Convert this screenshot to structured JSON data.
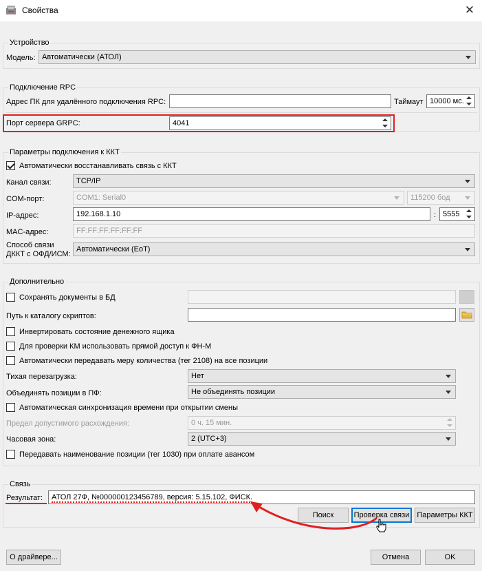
{
  "window": {
    "title": "Свойства",
    "close_glyph": "✕",
    "icon": "app-icon"
  },
  "device": {
    "legend": "Устройство",
    "model_label": "Модель:",
    "model_value": "Автоматически (АТОЛ)"
  },
  "rpc": {
    "legend": "Подключение RPC",
    "address_label": "Адрес ПК для удалённого подключения RPC:",
    "address_value": "",
    "timeout_label": "Таймаут",
    "timeout_value": "10000 мс.",
    "grpc_port_label": "Порт сервера GRPC:",
    "grpc_port_value": "4041"
  },
  "kkt": {
    "legend": "Параметры подключения к ККТ",
    "auto_restore_label": "Автоматически восстанавливать связь с ККТ",
    "auto_restore_checked": true,
    "channel_label": "Канал связи:",
    "channel_value": "TCP/IP",
    "com_label": "COM-порт:",
    "com_value": "COM1: Serial0",
    "baud_value": "115200 бод",
    "ip_label": "IP-адрес:",
    "ip_value": "192.168.1.10",
    "port_sep": ":",
    "port_value": "5555",
    "mac_label": "MAC-адрес:",
    "mac_value": "FF:FF:FF:FF:FF:FF",
    "ofd_label_line1": "Способ связи",
    "ofd_label_line2": "ДККТ с ОФД/ИСМ:",
    "ofd_value": "Автоматически (EoT)"
  },
  "extra": {
    "legend": "Дополнительно",
    "save_docs_label": "Сохранять документы в БД",
    "save_docs_path": "",
    "scripts_label": "Путь к каталогу скриптов:",
    "scripts_path": "",
    "invert_drawer_label": "Инвертировать состояние денежного ящика",
    "km_direct_label": "Для проверки КМ использовать прямой доступ к ФН-М",
    "tag2108_label": "Автоматически передавать меру количества (тег 2108) на все позиции",
    "silent_reboot_label": "Тихая перезагрузка:",
    "silent_reboot_value": "Нет",
    "merge_label": "Объединять позиции в ПФ:",
    "merge_value": "Не объединять позиции",
    "time_sync_label": "Автоматическая синхронизация времени при открытии смены",
    "tolerance_label": "Предел допустимого расхождения:",
    "tolerance_value": "0 ч. 15 мин.",
    "timezone_label": "Часовая зона:",
    "timezone_value": "2 (UTC+3)",
    "tag1030_label": "Передавать наименование позиции (тег 1030) при оплате авансом"
  },
  "link": {
    "legend": "Связь",
    "result_label": "Результат:",
    "result_value": "АТОЛ 27Ф, №000000123456789, версия: 5.15.102, ФИСК.",
    "search_button": "Поиск",
    "check_button": "Проверка связи",
    "kkt_params_button": "Параметры ККТ"
  },
  "footer": {
    "about_button": "О драйвере...",
    "cancel_button": "Отмена",
    "ok_button": "OK"
  },
  "colors": {
    "highlight": "#e02020",
    "focus": "#0078d7",
    "window_bg": "#f0f0f0"
  }
}
